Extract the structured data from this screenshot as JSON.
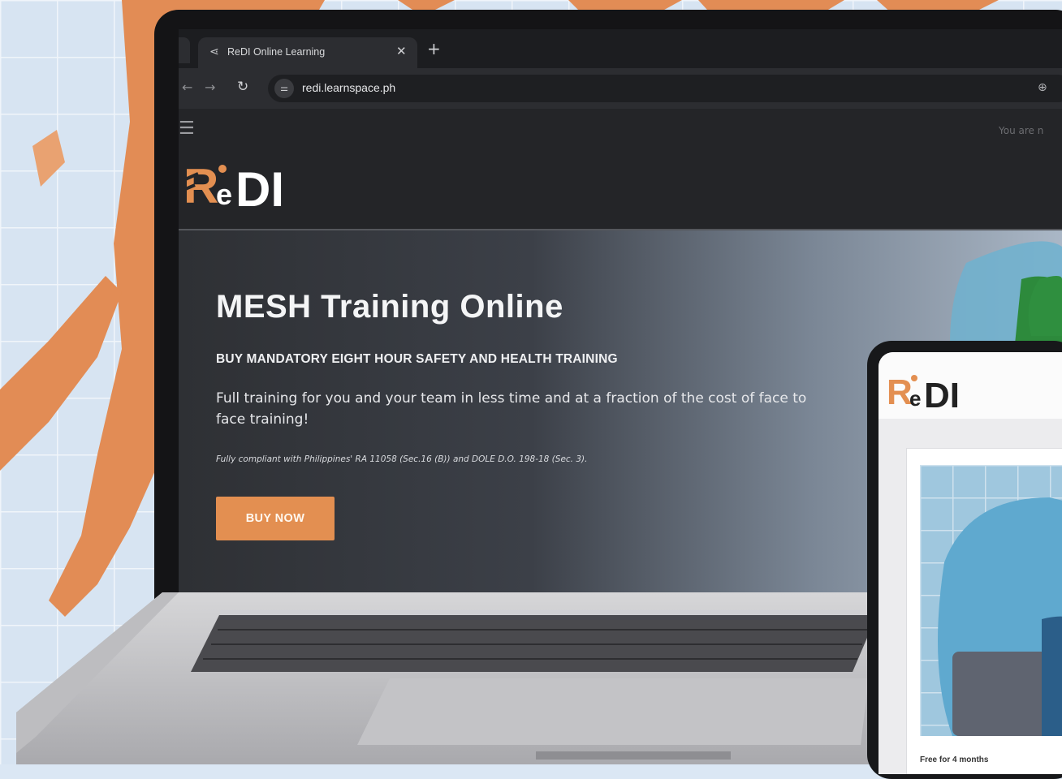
{
  "browser": {
    "tab_title": "ReDI Online Learning",
    "new_tab_label": "+",
    "url": "redi.learnspace.ph"
  },
  "site": {
    "logo_text": "ReDI",
    "login_status": "You are n"
  },
  "hero": {
    "title": "MESH Training Online",
    "subtitle": "BUY MANDATORY EIGHT HOUR SAFETY AND HEALTH TRAINING",
    "description": "Full training for you and your team in less time and at a fraction of the cost of face to face training!",
    "note": "Fully compliant with Philippines' RA 11058 (Sec.16 (B)) and DOLE D.O. 198-18 (Sec. 3).",
    "button_label": "BUY NOW"
  },
  "tablet": {
    "logo_text": "ReDI",
    "card_caption": "Free for 4 months"
  },
  "colors": {
    "accent": "#e38f51",
    "page_bg": "#242528",
    "backdrop": "#dbe7f4"
  },
  "icons": {
    "tab": "share-arrow-icon",
    "reload": "reload-icon",
    "site_info": "tune-icon",
    "zoom": "zoom-icon",
    "menu": "hamburger-icon"
  }
}
